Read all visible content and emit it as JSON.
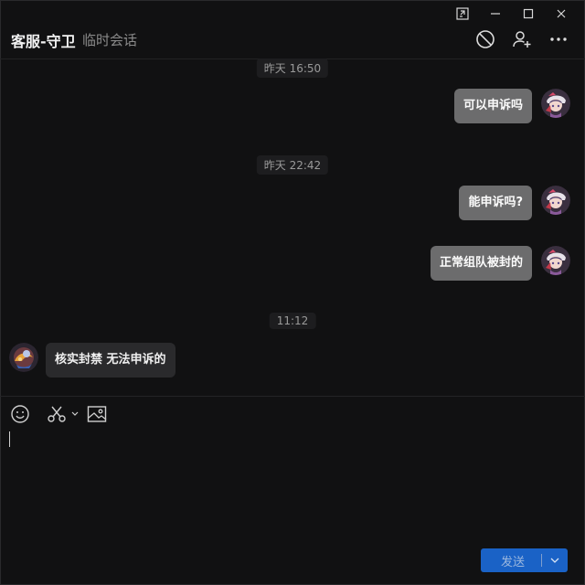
{
  "header": {
    "title": "客服-守卫",
    "subtitle": "临时会话"
  },
  "icons": {
    "window": [
      "pin-window-icon",
      "minimize-icon",
      "maximize-icon",
      "close-icon"
    ],
    "header": [
      "block-icon",
      "add-user-icon",
      "more-icon"
    ],
    "toolbar": [
      "emoji-icon",
      "scissors-icon",
      "chevron-down-icon",
      "image-icon"
    ]
  },
  "messages": [
    {
      "type": "time",
      "text": "昨天 16:50"
    },
    {
      "type": "out",
      "text": "可以申诉吗"
    },
    {
      "type": "time",
      "text": "昨天 22:42"
    },
    {
      "type": "out",
      "text": "能申诉吗?"
    },
    {
      "type": "out",
      "text": "正常组队被封的"
    },
    {
      "type": "time",
      "text": "11:12"
    },
    {
      "type": "in",
      "text": "核实封禁 无法申诉的"
    }
  ],
  "composer": {
    "value": "",
    "send_label": "发送"
  },
  "colors": {
    "accent": "#1a62c6",
    "outgoing_bubble": "#6c6c6d",
    "incoming_bubble": "#2a2a2c",
    "background": "#111112"
  }
}
